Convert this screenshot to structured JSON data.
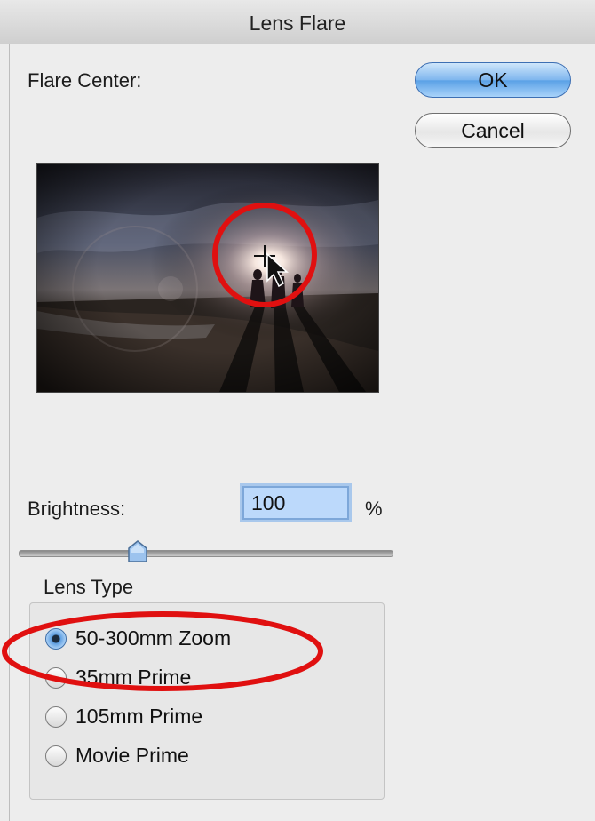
{
  "window": {
    "title": "Lens Flare"
  },
  "flare_center": {
    "label": "Flare Center:"
  },
  "buttons": {
    "ok": "OK",
    "cancel": "Cancel"
  },
  "brightness": {
    "label": "Brightness:",
    "value": "100",
    "unit": "%",
    "slider_fraction": 0.32
  },
  "lens_type": {
    "title": "Lens Type",
    "options": [
      {
        "label": "50-300mm Zoom",
        "checked": true
      },
      {
        "label": "35mm Prime",
        "checked": false
      },
      {
        "label": "105mm Prime",
        "checked": false
      },
      {
        "label": "Movie Prime",
        "checked": false
      }
    ]
  },
  "colors": {
    "default_button": "#6aaaf0",
    "annotation": "#e01010",
    "input_highlight": "#bcd9fb"
  }
}
